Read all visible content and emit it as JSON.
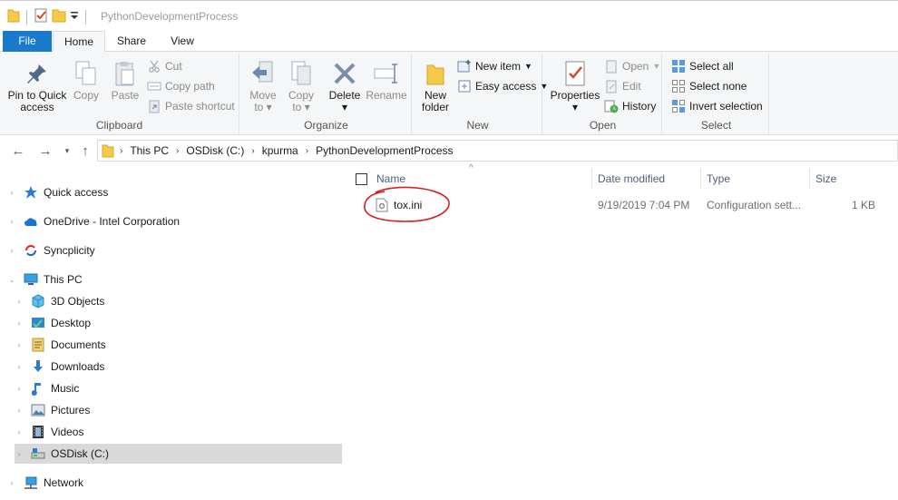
{
  "window": {
    "title": "PythonDevelopmentProcess"
  },
  "tabs": {
    "file": "File",
    "home": "Home",
    "share": "Share",
    "view": "View"
  },
  "ribbon": {
    "clipboard": {
      "label": "Clipboard",
      "pin_line1": "Pin to Quick",
      "pin_line2": "access",
      "copy": "Copy",
      "paste": "Paste",
      "cut": "Cut",
      "copy_path": "Copy path",
      "paste_shortcut": "Paste shortcut"
    },
    "organize": {
      "label": "Organize",
      "move_to": "Move",
      "move_to2": "to",
      "copy_to": "Copy",
      "copy_to2": "to",
      "delete": "Delete",
      "rename": "Rename"
    },
    "new": {
      "label": "New",
      "new_folder1": "New",
      "new_folder2": "folder",
      "new_item": "New item",
      "easy_access": "Easy access"
    },
    "open": {
      "label": "Open",
      "properties": "Properties",
      "open": "Open",
      "edit": "Edit",
      "history": "History"
    },
    "select": {
      "label": "Select",
      "select_all": "Select all",
      "select_none": "Select none",
      "invert": "Invert selection"
    }
  },
  "address": {
    "crumbs": [
      "This PC",
      "OSDisk (C:)",
      "kpurma",
      "PythonDevelopmentProcess"
    ]
  },
  "nav": {
    "items": [
      {
        "label": "Quick access"
      },
      {
        "label": "OneDrive - Intel Corporation"
      },
      {
        "label": "Syncplicity"
      },
      {
        "label": "This PC"
      },
      {
        "label": "3D Objects"
      },
      {
        "label": "Desktop"
      },
      {
        "label": "Documents"
      },
      {
        "label": "Downloads"
      },
      {
        "label": "Music"
      },
      {
        "label": "Pictures"
      },
      {
        "label": "Videos"
      },
      {
        "label": "OSDisk (C:)"
      },
      {
        "label": "Network"
      }
    ]
  },
  "columns": {
    "name": "Name",
    "date": "Date modified",
    "type": "Type",
    "size": "Size"
  },
  "files": [
    {
      "name": "tox.ini",
      "date": "9/19/2019 7:04 PM",
      "type": "Configuration sett...",
      "size": "1 KB"
    }
  ],
  "colors": {
    "accent": "#1979ca",
    "annotation": "#d42020",
    "selected_bg": "#d9d9d9"
  }
}
